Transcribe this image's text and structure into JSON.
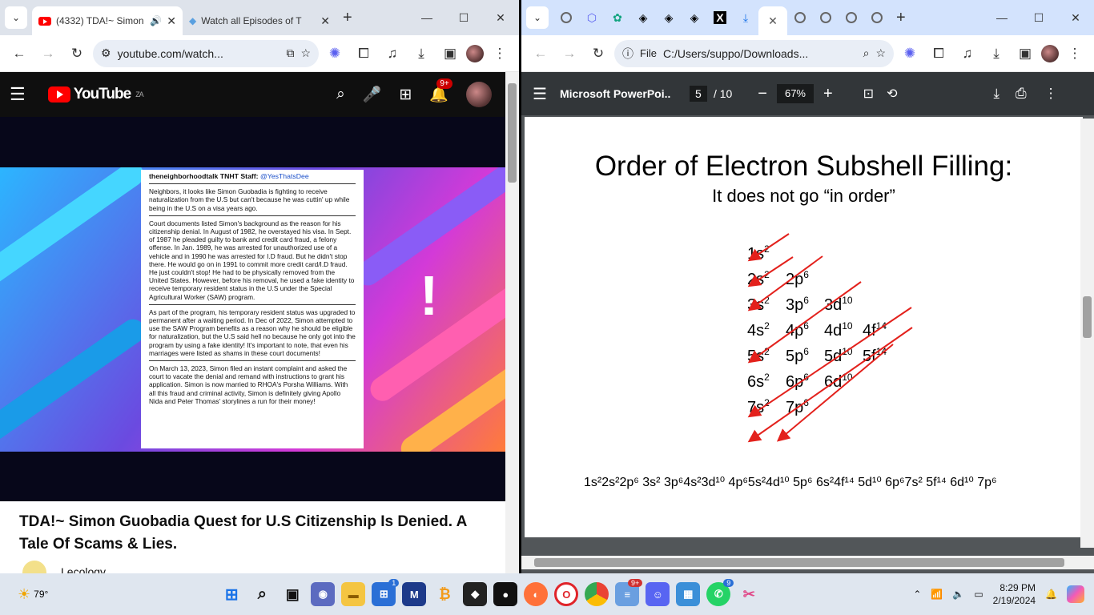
{
  "left_window": {
    "tabs": [
      {
        "title": "(4332) TDA!~ Simon",
        "active": true
      },
      {
        "title": "Watch all Episodes of T",
        "active": false
      }
    ],
    "url": "youtube.com/watch...",
    "youtube": {
      "logo": "YouTube",
      "region": "ZA",
      "notification_badge": "9+",
      "article": {
        "header_name": "theneighborhoodtalk TNHT Staff:",
        "header_handle": "@YesThatsDee",
        "p1": "Neighbors, it looks like Simon Guobadia is fighting to receive naturalization from the U.S but can't because he was cuttin' up while being in the U.S on a visa years ago.",
        "p2": "Court documents listed Simon's background as the reason for his citizenship denial. In August of 1982, he overstayed his visa. In Sept. of 1987 he pleaded guilty to bank and credit card fraud, a felony offense. In Jan. 1989, he was arrested for unauthorized use of a vehicle and in 1990 he was arrested for I.D fraud. But he didn't stop there. He would go on in 1991 to commit more credit card/I.D fraud. He just couldn't stop! He had to be physically removed from the United States. However, before his removal, he used a fake identity to receive temporary resident status in the U.S under the Special Agricultural Worker (SAW) program.",
        "p3": "As part of the program, his temporary resident status was upgraded to permanent after a waiting period. In Dec of 2022, Simon attempted to use the SAW Program benefits as a reason why he should be eligible for naturalization, but the U.S said hell no because he only got into the program by using a fake identity! It's important to note, that even his marriages were listed as shams in these court documents!",
        "p4": "On March 13, 2023, Simon filed an instant complaint and asked the court to vacate the denial and remand with instructions to grant his application. Simon is now married to RHOA's Porsha Williams. With all this fraud and criminal activity, Simon is definitely giving Apollo Nida and Peter Thomas' storylines a run for their money!"
      },
      "video_title": "TDA!~ Simon Guobadia Quest for U.S Citizenship Is Denied. A Tale Of Scams & Lies.",
      "channel": "Lecology"
    }
  },
  "right_window": {
    "url_prefix": "File",
    "url": "C:/Users/suppo/Downloads...",
    "pdf": {
      "title": "Microsoft PowerPoi...",
      "page_current": "5",
      "page_total": "/ 10",
      "zoom": "67%",
      "slide_title": "Order of Electron Subshell Filling:",
      "slide_subtitle": "It does not go “in order”",
      "rows": [
        [
          "1s",
          "2"
        ],
        [
          "2s",
          "2",
          "2p",
          "6"
        ],
        [
          "3s",
          "2",
          "3p",
          "6",
          "3d",
          "10"
        ],
        [
          "4s",
          "2",
          "4p",
          "6",
          "4d",
          "10",
          "4f",
          "14"
        ],
        [
          "5s",
          "2",
          "5p",
          "6",
          "5d",
          "10",
          "5f",
          "14"
        ],
        [
          "6s",
          "2",
          "6p",
          "6",
          "6d",
          "10"
        ],
        [
          "7s",
          "2",
          "7p",
          "6"
        ]
      ],
      "sequence": "1s²2s²2p⁶ 3s² 3p⁶4s²3d¹⁰ 4p⁶5s²4d¹⁰ 5p⁶ 6s²4f¹⁴ 5d¹⁰ 6p⁶7s² 5f¹⁴ 6d¹⁰ 7p⁶"
    }
  },
  "taskbar": {
    "weather": "79°",
    "time": "8:29 PM",
    "date": "2/19/2024",
    "badges": {
      "store": "1",
      "files": "9+",
      "whatsapp": "9"
    }
  },
  "colors": {
    "youtube_red": "#ff0000",
    "arrow_red": "#e3211c",
    "pdf_toolbar": "#323639"
  }
}
